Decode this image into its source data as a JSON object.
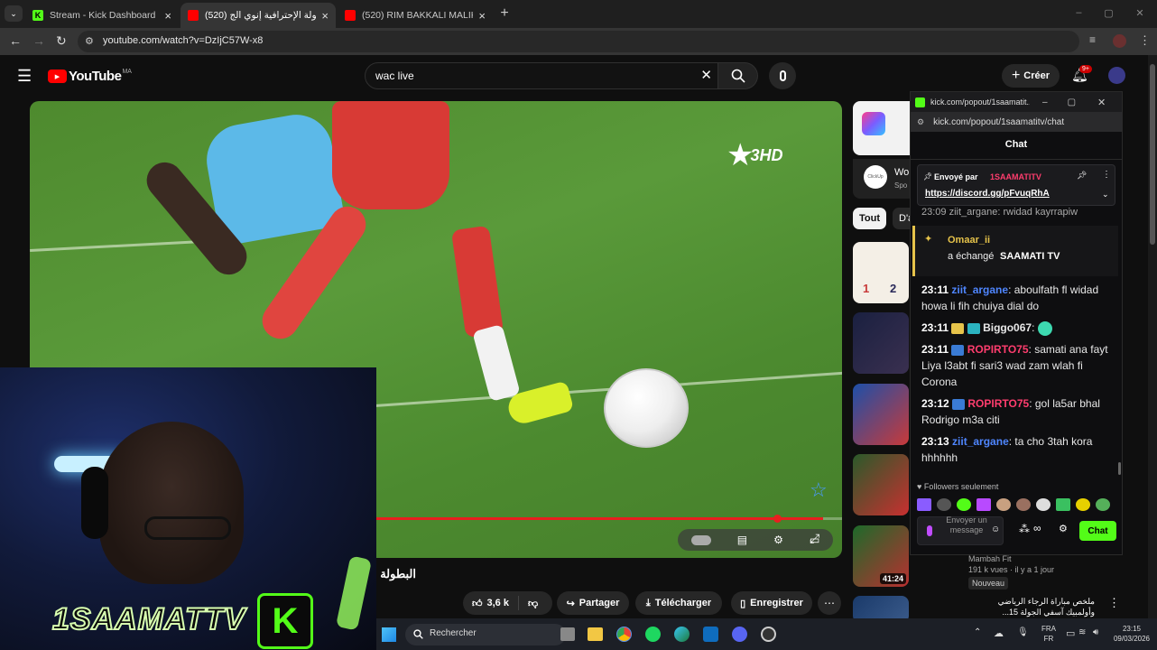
{
  "browser": {
    "tabs": [
      {
        "title": "Stream - Kick Dashboard",
        "favicon_color": "#53fc18",
        "favicon_letter": "K"
      },
      {
        "title": "(520) البطولة الإحترافية إنوي الج",
        "favicon_color": "#ff0000",
        "favicon_letter": "▶"
      },
      {
        "title": "(520) RIM BAKKALI MALIKNA H",
        "favicon_color": "#ff0000",
        "favicon_letter": "▶"
      }
    ],
    "url": "youtube.com/watch?v=DzIjC57W-x8"
  },
  "youtube": {
    "logo_text": "YouTube",
    "region": "MA",
    "search_value": "wac live",
    "create_label": "Créer",
    "notif_count": "9+",
    "video_title": "البطولة ا",
    "actions": {
      "likes": "3,6 k",
      "share": "Partager",
      "download": "Télécharger",
      "save": "Enregistrer"
    },
    "filter_chip": "Tout",
    "filter_chip2": "D'a",
    "ad_title": "Wo",
    "ad_sub": "Spo",
    "ad_label": "ClickUp",
    "recommended": [
      {
        "score": [
          "1",
          "2"
        ]
      },
      {},
      {},
      {},
      {
        "channel": "Mambah Fit",
        "meta": "191 k vues · il y a 1 jour",
        "badge": "Nouveau",
        "duration": "41:24"
      },
      {
        "title": "ملخص مباراة الرجاء الرياضي وأولمبيك آسفي الجولة 15..."
      }
    ],
    "channel_overlay": "3HD"
  },
  "webcam": {
    "streamer_name": "1SAAMATTV",
    "kick_letter": "K"
  },
  "kick_popout": {
    "url_title": "kick.com/popout/1saamatit...",
    "url": "kick.com/popout/1saamatitv/chat",
    "header": "Chat",
    "pinned_by_label": "Envoyé par",
    "pinned_by_user": "1SAAMATITV",
    "pinned_link": "https://discord.gg/pFvuqRhA",
    "cut_line": "23:09 ziit_argane: rwidad kayrrapiw",
    "redeem": {
      "user": "Omaar_ii",
      "text": "a échangé",
      "reward": "SAAMATI TV"
    },
    "messages": [
      {
        "time": "23:11",
        "user": "ziit_argane",
        "color": "#4f86ff",
        "text": ": aboulfath fl widad howa li fih chuiya dial do"
      },
      {
        "time": "23:11",
        "user": "Biggo067",
        "color": "#ffffff",
        "text": ":",
        "badges": true
      },
      {
        "time": "23:11",
        "user": "ROPIRTO75",
        "color": "#ff3d6e",
        "text": ": samati ana fayt Liya l3abt fi sari3 wad zam wlah fi Corona",
        "badges": true
      },
      {
        "time": "23:12",
        "user": "ROPIRTO75",
        "color": "#ff3d6e",
        "text": ": gol la5ar bhal Rodrigo m3a citi",
        "badges": true
      },
      {
        "time": "23:13",
        "user": "ziit_argane",
        "color": "#4f86ff",
        "text": ": ta cho 3tah kora hhhhhh"
      }
    ],
    "followers_only": "Followers seulement",
    "input_placeholder": "Envoyer un message",
    "send_label": "Chat"
  },
  "taskbar": {
    "search_placeholder": "Rechercher",
    "lang1": "FRA",
    "lang2": "FR",
    "time": "23:15",
    "date": "09/03/2026"
  }
}
